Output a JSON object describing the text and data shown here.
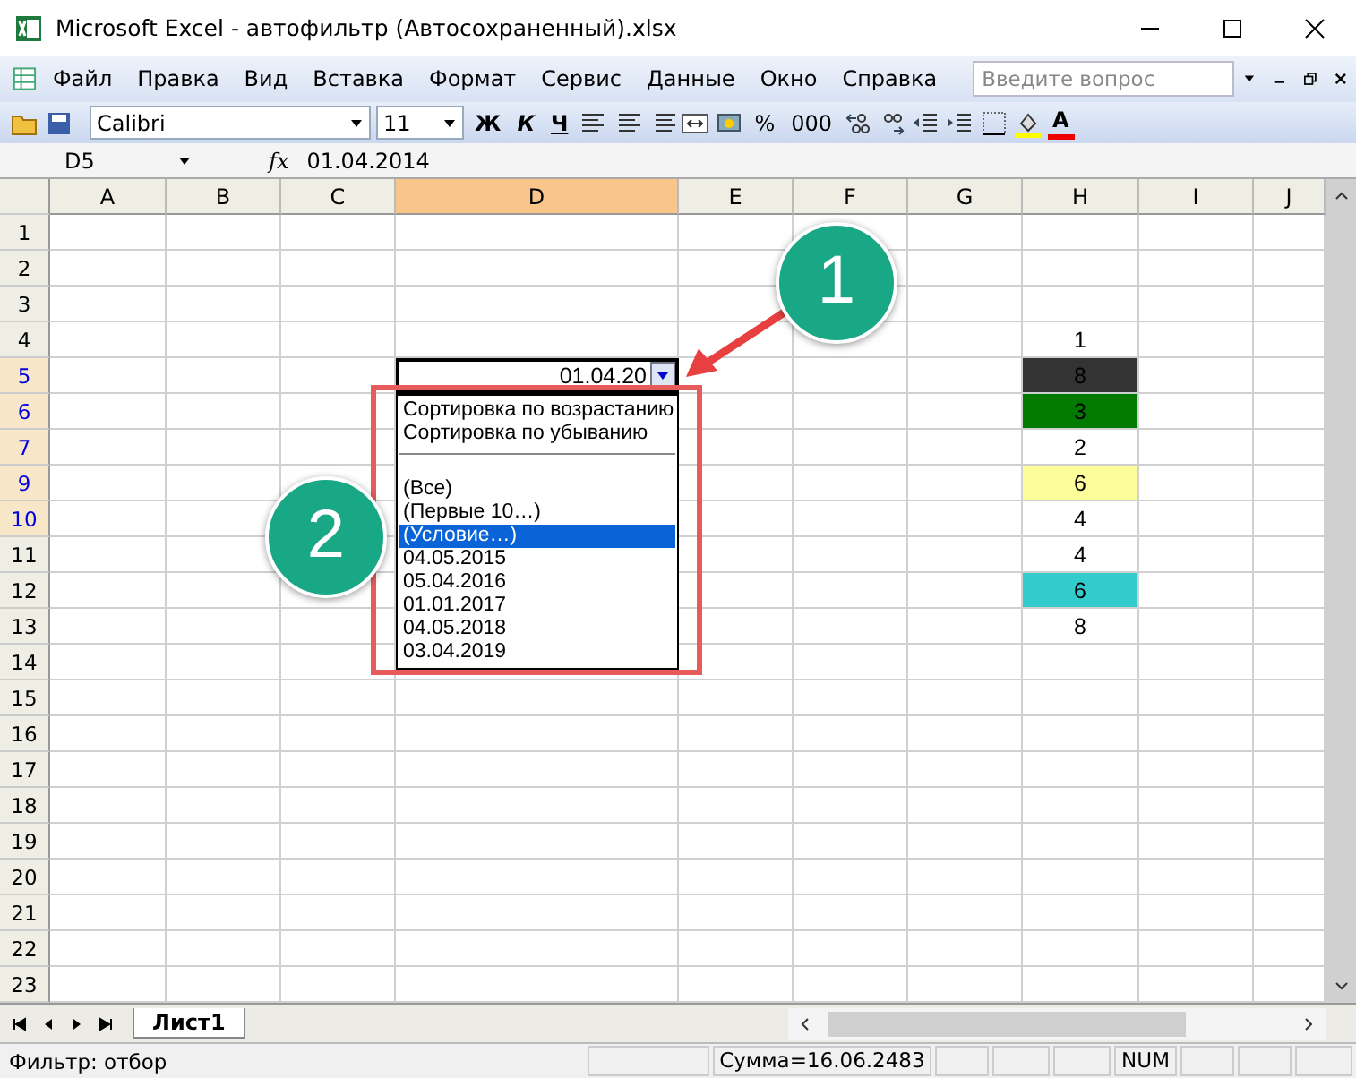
{
  "window": {
    "title": "Microsoft Excel - автофильтр (Автосохраненный).xlsx"
  },
  "menu": [
    "Файл",
    "Правка",
    "Вид",
    "Вставка",
    "Формат",
    "Сервис",
    "Данные",
    "Окно",
    "Справка"
  ],
  "help_search": {
    "placeholder": "Введите вопрос"
  },
  "toolbar": {
    "font": "Calibri",
    "size": "11",
    "bold": "Ж",
    "italic": "К",
    "underline": "Ч",
    "percent": "%",
    "thousands": "000",
    "font_color": "A"
  },
  "formula_bar": {
    "name_box": "D5",
    "fx": "fx",
    "value": "01.04.2014"
  },
  "columns": [
    {
      "label": "A",
      "selected": false
    },
    {
      "label": "B",
      "selected": false
    },
    {
      "label": "C",
      "selected": false
    },
    {
      "label": "D",
      "selected": true
    },
    {
      "label": "E",
      "selected": false
    },
    {
      "label": "F",
      "selected": false
    },
    {
      "label": "G",
      "selected": false
    },
    {
      "label": "H",
      "selected": false
    },
    {
      "label": "I",
      "selected": false
    },
    {
      "label": "J",
      "selected": false
    }
  ],
  "rows": [
    {
      "label": "1",
      "filtered": false
    },
    {
      "label": "2",
      "filtered": false
    },
    {
      "label": "3",
      "filtered": false
    },
    {
      "label": "4",
      "filtered": false,
      "h": "1"
    },
    {
      "label": "5",
      "filtered": true,
      "d": "01.04.20",
      "h": "8",
      "color": "#333333"
    },
    {
      "label": "6",
      "filtered": true,
      "h": "3",
      "color": "#007a00"
    },
    {
      "label": "7",
      "filtered": true,
      "h": "2"
    },
    {
      "label": "9",
      "filtered": true,
      "h": "6",
      "color": "#fdfd9c"
    },
    {
      "label": "10",
      "filtered": true,
      "h": "4"
    },
    {
      "label": "11",
      "filtered": false,
      "h": "4"
    },
    {
      "label": "12",
      "filtered": false,
      "h": "6",
      "color": "#33cccc"
    },
    {
      "label": "13",
      "filtered": false,
      "h": "8"
    },
    {
      "label": "14",
      "filtered": false
    },
    {
      "label": "15",
      "filtered": false
    },
    {
      "label": "16",
      "filtered": false
    },
    {
      "label": "17",
      "filtered": false
    },
    {
      "label": "18",
      "filtered": false
    },
    {
      "label": "19",
      "filtered": false
    },
    {
      "label": "20",
      "filtered": false
    },
    {
      "label": "21",
      "filtered": false
    },
    {
      "label": "22",
      "filtered": false
    },
    {
      "label": "23",
      "filtered": false
    }
  ],
  "filter_dropdown": [
    {
      "kind": "item",
      "label": "Сортировка по возрастанию",
      "selected": false
    },
    {
      "kind": "item",
      "label": "Сортировка по убыванию",
      "selected": false
    },
    {
      "kind": "separator"
    },
    {
      "kind": "item",
      "label": "(Все)",
      "selected": false
    },
    {
      "kind": "item",
      "label": "(Первые 10…)",
      "selected": false
    },
    {
      "kind": "item",
      "label": "(Условие…)",
      "selected": true
    },
    {
      "kind": "item",
      "label": "04.05.2015",
      "selected": false
    },
    {
      "kind": "item",
      "label": "05.04.2016",
      "selected": false
    },
    {
      "kind": "item",
      "label": "01.01.2017",
      "selected": false
    },
    {
      "kind": "item",
      "label": "04.05.2018",
      "selected": false
    },
    {
      "kind": "item",
      "label": "03.04.2019",
      "selected": false
    }
  ],
  "annotations": [
    "1",
    "2"
  ],
  "sheet_tabs": [
    {
      "label": "Лист1",
      "selected": true
    }
  ],
  "status_bar": {
    "mode": "Фильтр: отбор",
    "sum": "Сумма=16.06.2483",
    "num": "NUM"
  }
}
